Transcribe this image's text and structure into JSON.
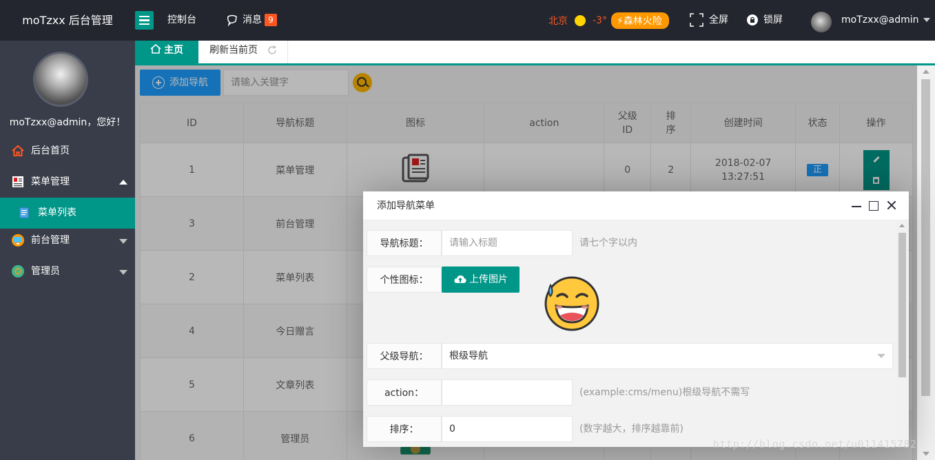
{
  "header": {
    "logo": "moTzxx 后台管理",
    "nav_console": "控制台",
    "nav_messages": "消息",
    "message_count": "9",
    "weather_city": "北京",
    "weather_temp": "-3°",
    "weather_warning": "森林火险",
    "fullscreen": "全屏",
    "lock": "锁屏",
    "user": "moTzxx@admin"
  },
  "sidebar": {
    "welcome": "moTzxx@admin，您好！",
    "items": [
      {
        "label": "后台首页"
      },
      {
        "label": "菜单管理"
      },
      {
        "label": "菜单列表"
      },
      {
        "label": "前台管理"
      },
      {
        "label": "管理员"
      }
    ]
  },
  "tabs": {
    "home": "主页",
    "refresh": "刷新当前页"
  },
  "toolbar": {
    "add_label": "添加导航",
    "search_placeholder": "请输入关键字"
  },
  "table": {
    "headers": [
      "ID",
      "导航标题",
      "图标",
      "action",
      "父级ID",
      "排序",
      "创建时间",
      "状态",
      "操作"
    ],
    "rows": [
      {
        "id": "1",
        "title": "菜单管理",
        "action": "",
        "parent": "0",
        "sort": "2",
        "created": "2018-02-07 13:27:51",
        "status": "正"
      },
      {
        "id": "3",
        "title": "前台管理",
        "action": "",
        "parent": "",
        "sort": "",
        "created": "",
        "status": ""
      },
      {
        "id": "2",
        "title": "菜单列表",
        "action": "",
        "parent": "",
        "sort": "",
        "created": "",
        "status": ""
      },
      {
        "id": "4",
        "title": "今日赠言",
        "action": "",
        "parent": "",
        "sort": "",
        "created": "",
        "status": ""
      },
      {
        "id": "5",
        "title": "文章列表",
        "action": "",
        "parent": "",
        "sort": "",
        "created": "",
        "status": ""
      },
      {
        "id": "6",
        "title": "管理员",
        "action": "",
        "parent": "",
        "sort": "",
        "created": "",
        "status": ""
      }
    ]
  },
  "dialog": {
    "title": "添加导航菜单",
    "fields": {
      "title_label": "导航标题：",
      "title_placeholder": "请输入标题",
      "title_hint": "请七个字以内",
      "icon_label": "个性图标：",
      "upload_label": "上传图片",
      "parent_label": "父级导航：",
      "parent_value": "根级导航",
      "action_label": "action：",
      "action_hint": "(example:cms/menu)根级导航不需写",
      "sort_label": "排序：",
      "sort_value": "0",
      "sort_hint": "(数字越大，排序越靠前)"
    }
  },
  "watermark": "http://blog.csdn.net/u011415782",
  "colors": {
    "header_bg": "#23262e",
    "sidebar_bg": "#393d49",
    "primary": "#009688",
    "blue": "#1e9fff",
    "warn": "#ff5722",
    "yellow": "#ffb800"
  }
}
